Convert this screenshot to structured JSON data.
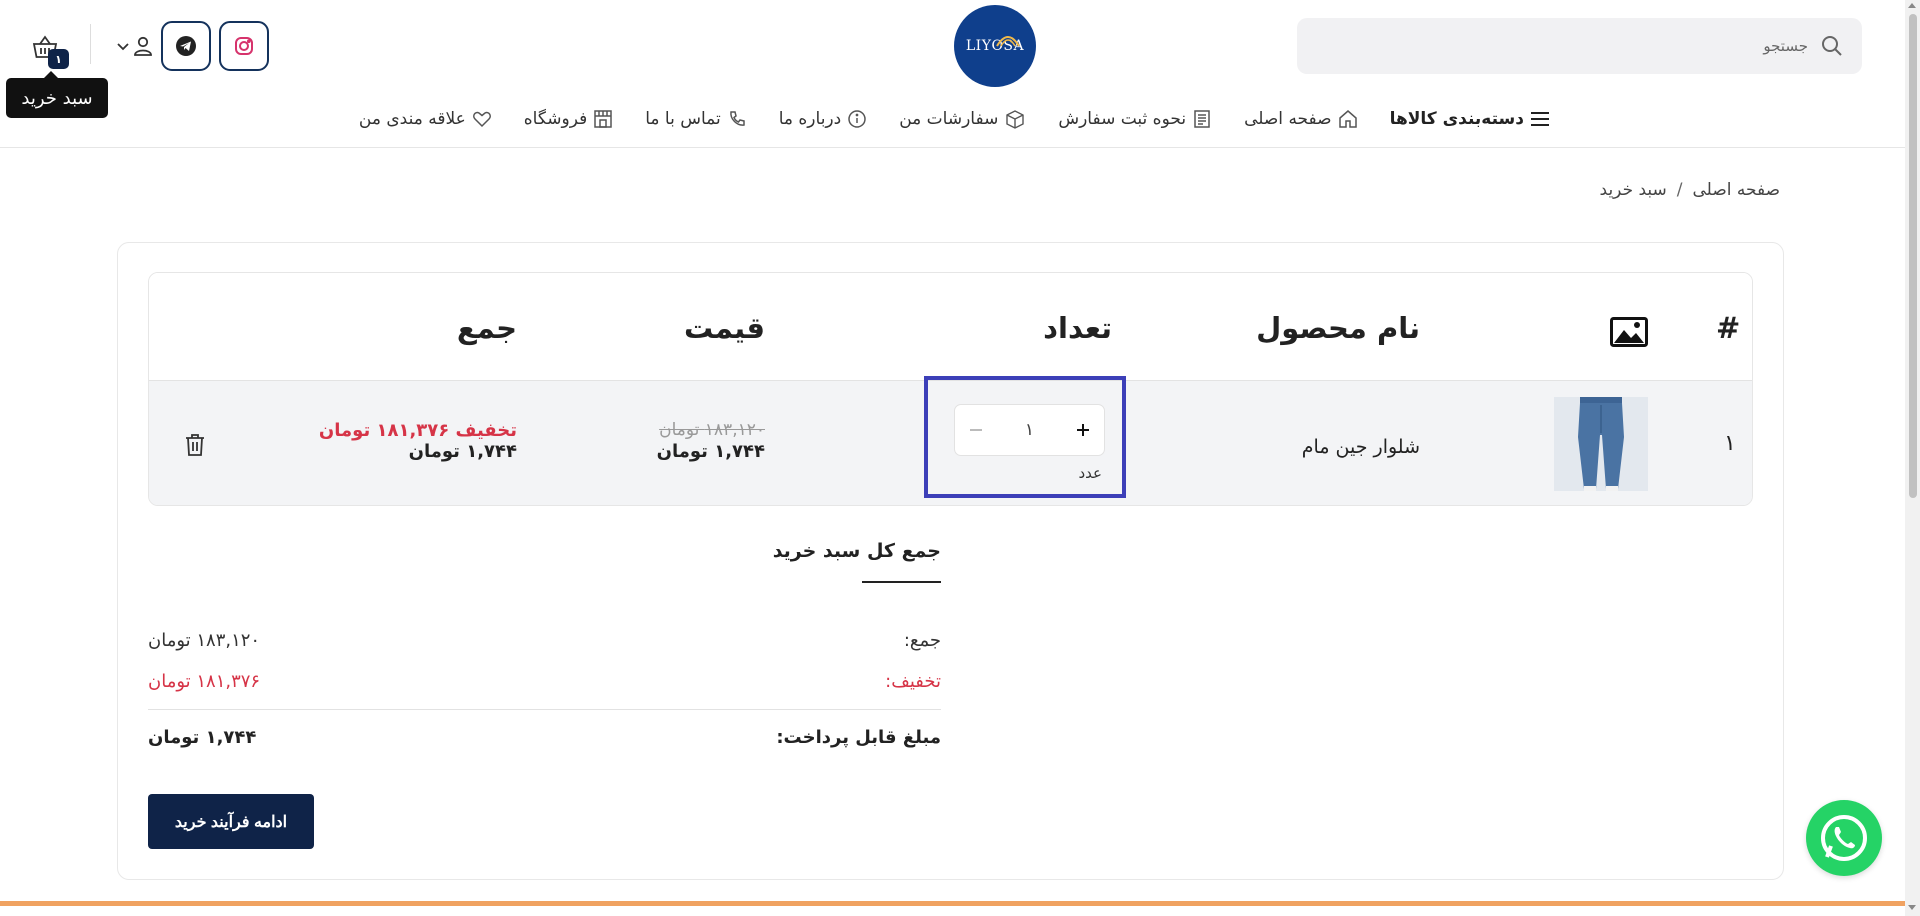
{
  "header": {
    "search_placeholder": "جستجو",
    "logo_text": "LIYOSA",
    "cart_count": "۱",
    "cart_tooltip": "سبد خرید",
    "brand_color": "#0f2348",
    "icons": {
      "search": "search-icon",
      "instagram": "instagram-icon",
      "telegram": "telegram-icon",
      "user": "user-icon",
      "cart": "basket-icon"
    }
  },
  "nav": {
    "items": [
      {
        "label": "دسته‌بندی کالاها",
        "icon": "menu-icon"
      },
      {
        "label": "صفحه اصلی",
        "icon": "home-icon"
      },
      {
        "label": "نحوه ثبت سفارش",
        "icon": "document-icon"
      },
      {
        "label": "سفارشات من",
        "icon": "box-icon"
      },
      {
        "label": "درباره ما",
        "icon": "info-icon"
      },
      {
        "label": "تماس با ما",
        "icon": "phone-icon"
      },
      {
        "label": "فروشگاه",
        "icon": "store-icon"
      },
      {
        "label": "علاقه مندی من",
        "icon": "heart-icon"
      }
    ]
  },
  "breadcrumb": {
    "home": "صفحه اصلی",
    "separator": "/",
    "current": "سبد خرید"
  },
  "cart_table": {
    "headers": {
      "index": "#",
      "product_name": "نام محصول",
      "quantity": "تعداد",
      "price": "قیمت",
      "total": "جمع"
    },
    "rows": [
      {
        "index": "۱",
        "product_name": "شلوار جین مام",
        "quantity": "۱",
        "unit": "عدد",
        "price_old": "۱۸۳,۱۲۰ تومان",
        "price_new": "۱,۷۴۴ تومان",
        "discount": "تخفیف ۱۸۱,۳۷۶ تومان",
        "total": "۱,۷۴۴ تومان"
      }
    ]
  },
  "totals": {
    "title": "جمع کل سبد خرید",
    "subtotal_label": "جمع:",
    "subtotal_value": "۱۸۳,۱۲۰ تومان",
    "discount_label": "تخفیف:",
    "discount_value": "۱۸۱,۳۷۶ تومان",
    "payable_label": "مبلغ قابل پرداخت:",
    "payable_value": "۱,۷۴۴ تومان",
    "checkout_label": "ادامه فرآیند خرید"
  },
  "colors": {
    "accent_red": "#d63447",
    "highlight_border": "#3c3fb8",
    "whatsapp": "#25d366",
    "bottom_bar": "#f0a261"
  }
}
